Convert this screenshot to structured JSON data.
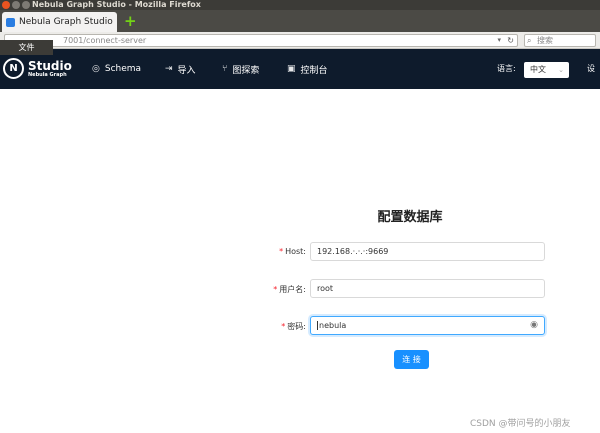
{
  "window": {
    "title": "Nebula Graph Studio - Mozilla Firefox"
  },
  "browser": {
    "tab_title": "Nebula Graph Studio",
    "url_visible": "7001/connect-server",
    "search_placeholder": "搜索",
    "file_menu": "文件"
  },
  "app": {
    "logo_name": "Studio",
    "logo_sub": "Nebula Graph",
    "logo_mark": "N",
    "nav": [
      {
        "label": "Schema",
        "icon": "schema-icon",
        "glyph": "◎"
      },
      {
        "label": "导入",
        "icon": "import-icon",
        "glyph": "⇥"
      },
      {
        "label": "图探索",
        "icon": "explore-icon",
        "glyph": "⑂"
      },
      {
        "label": "控制台",
        "icon": "console-icon",
        "glyph": "▣"
      }
    ],
    "language_label": "语言:",
    "language_value": "中文",
    "settings_label": "设置"
  },
  "form": {
    "title": "配置数据库",
    "host_label": "Host:",
    "host_value": "192.168.·.·.·:9669",
    "username_label": "用户名:",
    "username_value": "root",
    "password_label": "密码:",
    "password_value": "nebula",
    "required_mark": "*",
    "connect_label": "连 接"
  },
  "watermark": "CSDN @带问号的小朋友",
  "colors": {
    "header_bg": "#0e1b2c",
    "primary": "#1890ff",
    "required": "#f5222d"
  }
}
